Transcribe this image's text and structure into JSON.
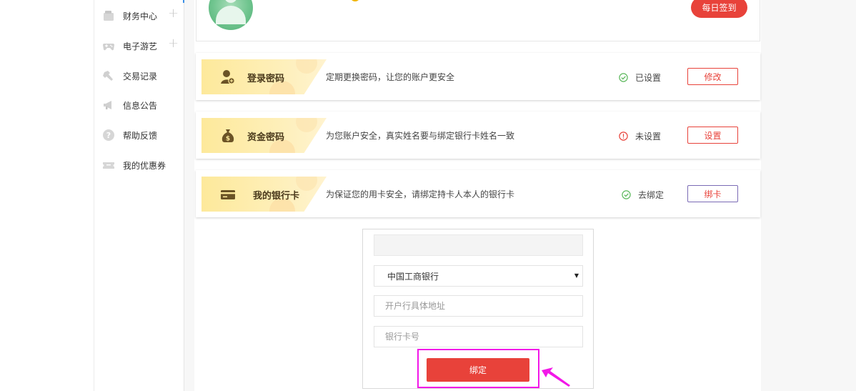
{
  "sidebar": {
    "items": [
      {
        "label": "财务中心",
        "icon": "wallet-icon",
        "expandable": true
      },
      {
        "label": "电子游艺",
        "icon": "gamepad-icon",
        "expandable": true
      },
      {
        "label": "交易记录",
        "icon": "hammer-icon",
        "expandable": false
      },
      {
        "label": "信息公告",
        "icon": "megaphone-icon",
        "expandable": false
      },
      {
        "label": "帮助反馈",
        "icon": "help-icon",
        "expandable": false
      },
      {
        "label": "我的优惠券",
        "icon": "ticket-icon",
        "expandable": false
      }
    ],
    "plus": "+"
  },
  "profile": {
    "sign_in_label": "每日签到"
  },
  "security": {
    "items": [
      {
        "title": "登录密码",
        "icon": "user-add-icon",
        "desc": "定期更换密码，让您的账户更安全",
        "status": "已设置",
        "status_icon": "check-circle-icon",
        "action": "修改"
      },
      {
        "title": "资金密码",
        "icon": "money-bag-icon",
        "desc": "为您账户安全，真实姓名要与绑定银行卡姓名一致",
        "status": "未设置",
        "status_icon": "alert-circle-icon",
        "action": "设置"
      },
      {
        "title": "我的银行卡",
        "icon": "bank-card-icon",
        "desc": "为保证您的用卡安全，请绑定持卡人本人的银行卡",
        "status": "去绑定",
        "status_icon": "check-circle-icon",
        "action": "绑卡"
      }
    ]
  },
  "bind_form": {
    "name_value": "",
    "bank_selected": "中国工商银行",
    "branch_placeholder": "开户行具体地址",
    "card_placeholder": "银行卡号",
    "submit_label": "绑定"
  },
  "colors": {
    "accent": "#e8423a",
    "success": "#5cb85c",
    "warning": "#e8423a",
    "highlight": "#f217e8"
  }
}
